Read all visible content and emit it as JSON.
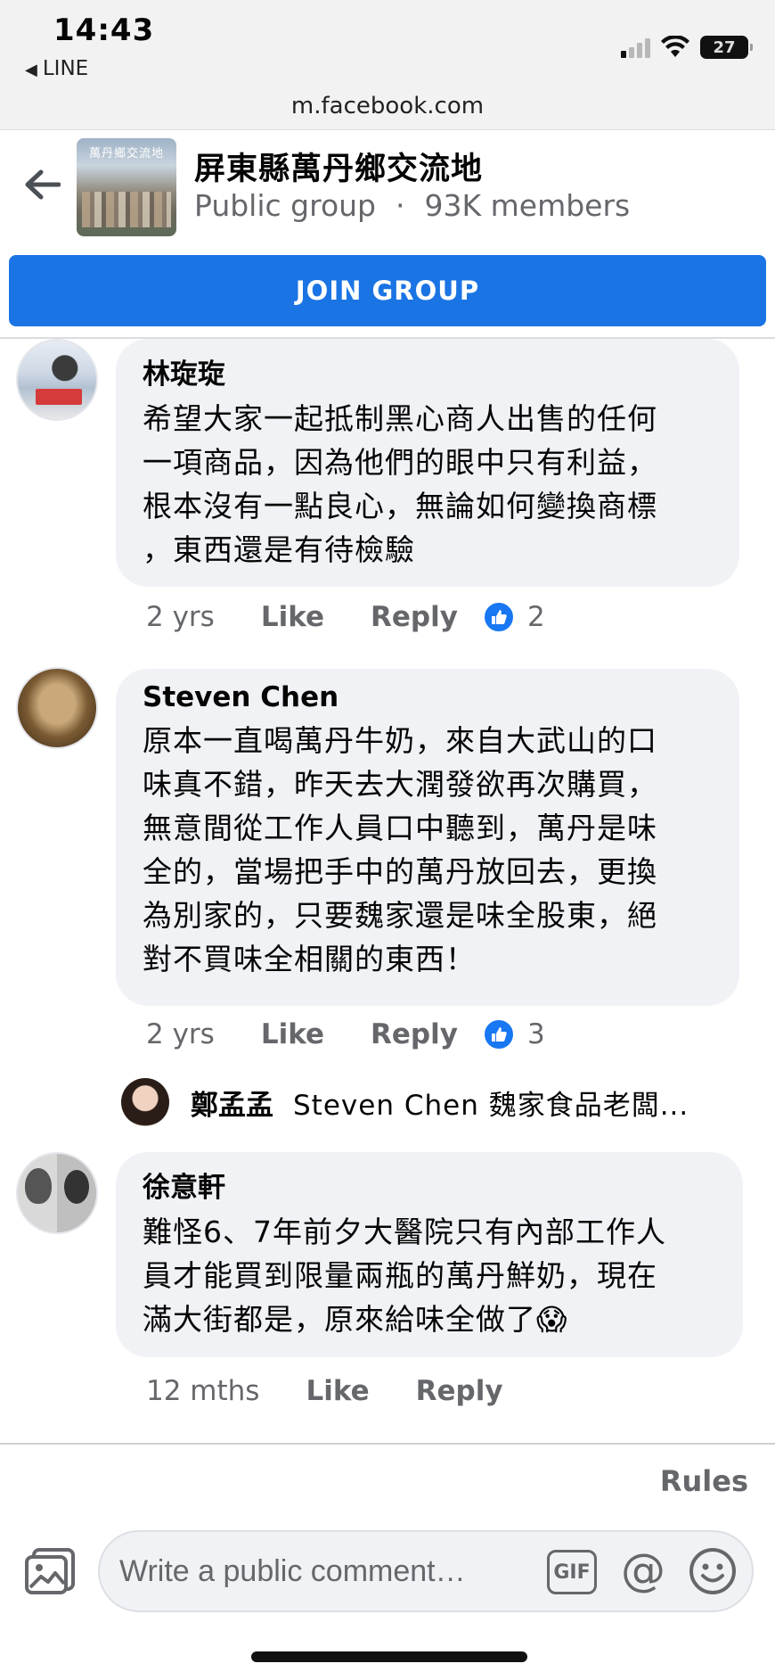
{
  "status_bar": {
    "time": "14:43",
    "back_app": "LINE",
    "battery": "27"
  },
  "browser": {
    "url": "m.facebook.com"
  },
  "group": {
    "name": "屏東縣萬丹鄉交流地",
    "photo_caption": "萬丹鄉交流地",
    "privacy": "Public group",
    "members": "93K members",
    "join_label": "JOIN GROUP"
  },
  "comments": [
    {
      "author": "林琁琁",
      "text": "希望大家一起抵制黑心商人出售的任何\n一項商品，因為他們的眼中只有利益，\n根本沒有一點良心，無論如何變換商標\n，東西還是有待檢驗",
      "time": "2 yrs",
      "like_label": "Like",
      "reply_label": "Reply",
      "reactions": "2"
    },
    {
      "author": "Steven Chen",
      "text": "原本一直喝萬丹牛奶，來自大武山的口\n味真不錯，昨天去大潤發欲再次購買，\n無意間從工作人員口中聽到，萬丹是味\n全的，當場把手中的萬丹放回去，更換\n為別家的，只要魏家還是味全股東，絕\n對不買味全相關的東西！",
      "time": "2 yrs",
      "like_label": "Like",
      "reply_label": "Reply",
      "reactions": "3",
      "reply_preview": {
        "author": "鄭孟孟",
        "text": "Steven Chen 魏家食品老闆..."
      }
    },
    {
      "author": "徐意軒",
      "text": "難怪6、7年前夕大醫院只有內部工作人\n員才能買到限量兩瓶的萬丹鮮奶，現在\n滿大街都是，原來給味全做了😱",
      "time": "12 mths",
      "like_label": "Like",
      "reply_label": "Reply"
    }
  ],
  "footer": {
    "rules_label": "Rules",
    "comment_placeholder": "Write a public comment…",
    "gif_label": "GIF",
    "mention_symbol": "@"
  },
  "icons": {
    "back": "back-arrow-icon",
    "like": "thumbs-up-icon",
    "photo": "photo-icon",
    "emoji": "smiley-icon"
  },
  "colors": {
    "accent": "#1b74e4",
    "bubble": "#f0f2f5",
    "secondary_text": "#65676b"
  }
}
